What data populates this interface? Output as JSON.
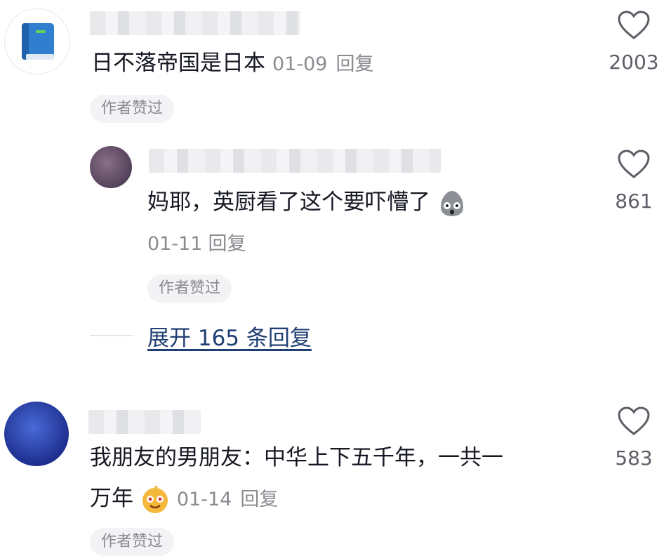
{
  "comments": [
    {
      "avatar_icon": "book-icon",
      "text": "日不落帝国是日本",
      "date": "01-09",
      "reply_label": "回复",
      "badge": "作者赞过",
      "likes": "2003"
    },
    {
      "avatar_icon": "user-avatar",
      "text": "妈耶，英厨看了这个要吓懵了",
      "emoji": "shocked-emoji",
      "date": "01-11",
      "reply_label": "回复",
      "badge": "作者赞过",
      "likes": "861",
      "is_reply": true
    },
    {
      "avatar_icon": "user-avatar",
      "text_line1": "我朋友的男朋友：中华上下五千年，一共一",
      "text_line2": "万年",
      "emoji": "happy-emoji",
      "date": "01-14",
      "reply_label": "回复",
      "badge": "作者赞过",
      "likes": "583"
    }
  ],
  "expand_replies": "展开 165 条回复",
  "colors": {
    "link": "#1f3f73",
    "meta": "#8a8b91",
    "badge_bg": "#f3f3f5"
  }
}
